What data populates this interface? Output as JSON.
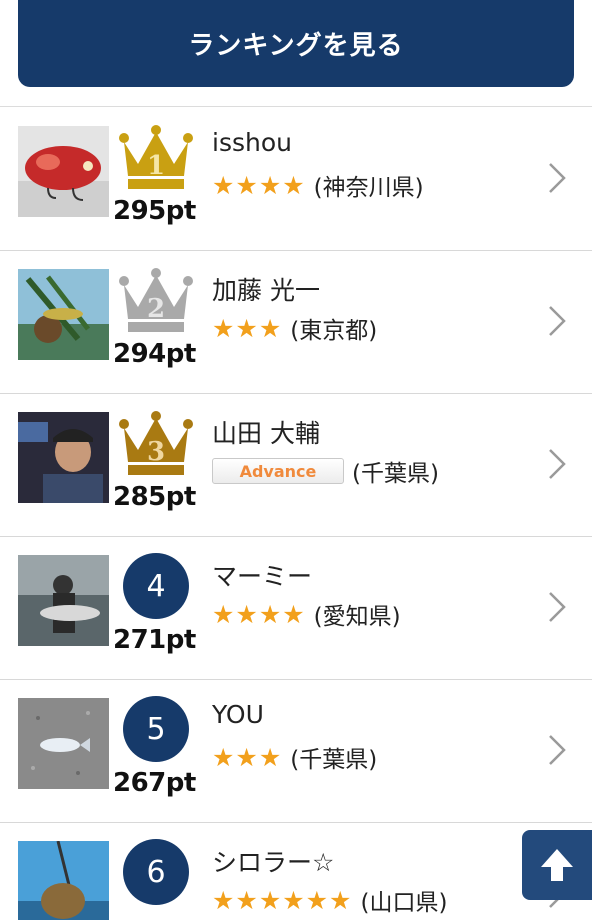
{
  "header": {
    "ranking_button_label": "ランキングを見る"
  },
  "rows": [
    {
      "rank": "1",
      "badge": "gold-crown",
      "points": "295pt",
      "name": "isshou",
      "stars": "★★★★",
      "prefecture": "(神奈川県)",
      "photo": "red-lure-photo"
    },
    {
      "rank": "2",
      "badge": "silver-crown",
      "points": "294pt",
      "name": "加藤 光一",
      "stars": "★★★",
      "prefecture": "(東京都)",
      "photo": "angler-fish-photo"
    },
    {
      "rank": "3",
      "badge": "bronze-crown",
      "points": "285pt",
      "name": "山田 大輔",
      "level_badge": "Advance",
      "prefecture": "(千葉県)",
      "photo": "angler-portrait-photo"
    },
    {
      "rank": "4",
      "badge": "circle",
      "points": "271pt",
      "name": "マーミー",
      "stars": "★★★★",
      "prefecture": "(愛知県)",
      "photo": "angler-big-fish-photo"
    },
    {
      "rank": "5",
      "badge": "circle",
      "points": "267pt",
      "name": "YOU",
      "stars": "★★★",
      "prefecture": "(千葉県)",
      "photo": "fish-on-ground-photo"
    },
    {
      "rank": "6",
      "badge": "circle",
      "points": "",
      "name": "シロラー☆",
      "stars": "★★★★★★",
      "prefecture": "(山口県)",
      "photo": "flatfish-catch-photo"
    }
  ],
  "colors": {
    "navy": "#163a6a",
    "gold": "#c9a012",
    "silver": "#a9a9a9",
    "bronze": "#a97a12",
    "star": "#f2a01c"
  },
  "icons": {
    "chevron": "chevron-right-icon",
    "back_to_top": "arrow-up-icon"
  }
}
